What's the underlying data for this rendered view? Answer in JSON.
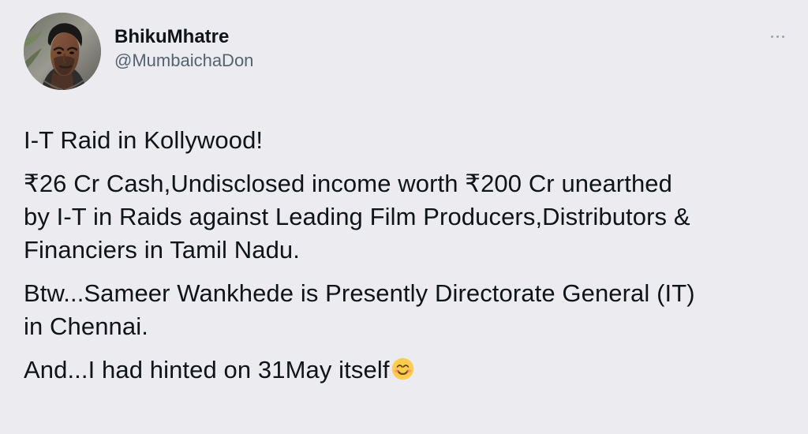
{
  "tweet": {
    "author": {
      "display_name": "BhikuMhatre",
      "handle": "@MumbaichaDon",
      "avatar_icon": "profile-photo"
    },
    "more_icon": "more-options-icon",
    "paragraphs": [
      {
        "lines": [
          "I-T Raid in Kollywood!"
        ]
      },
      {
        "lines": [
          "₹26 Cr Cash,Undisclosed income worth ₹200 Cr unearthed",
          "by I-T in Raids against Leading Film Producers,Distributors &",
          "Financiers in Tamil Nadu."
        ]
      },
      {
        "lines": [
          "Btw...Sameer Wankhede is Presently Directorate General (IT)",
          "in Chennai."
        ]
      },
      {
        "lines": [
          "And...I had hinted on 31May itself"
        ],
        "emoji": "smiling-face-emoji"
      }
    ]
  }
}
